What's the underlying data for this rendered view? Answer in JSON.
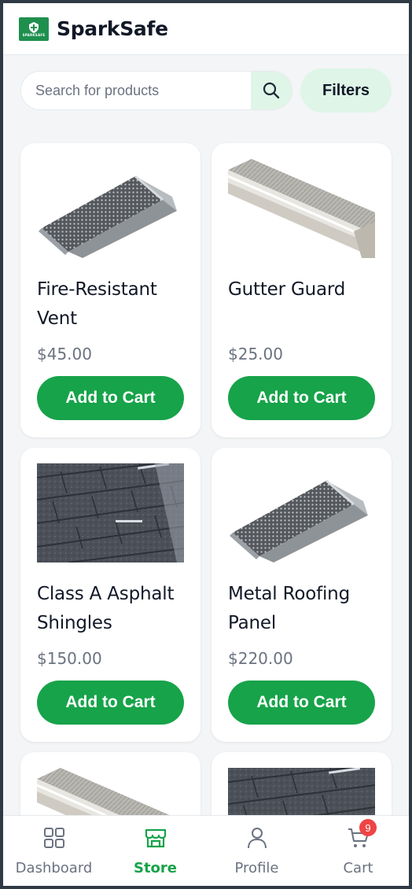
{
  "app": {
    "title": "SparkSafe",
    "logo_text": "SPARKSAFE",
    "brand_color": "#1f8f4e",
    "accent_color": "#17a34a"
  },
  "search": {
    "placeholder": "Search for products",
    "value": "",
    "icon": "search-icon"
  },
  "filters_label": "Filters",
  "products": [
    {
      "name": "Fire-Resistant Vent",
      "price": "$45.00",
      "cta": "Add to Cart",
      "image": "vent"
    },
    {
      "name": "Gutter Guard",
      "price": "$25.00",
      "cta": "Add to Cart",
      "image": "gutter"
    },
    {
      "name": "Class A Asphalt Shingles",
      "price": "$150.00",
      "cta": "Add to Cart",
      "image": "shingles"
    },
    {
      "name": "Metal Roofing Panel",
      "price": "$220.00",
      "cta": "Add to Cart",
      "image": "vent"
    },
    {
      "name": "",
      "price": "",
      "cta": "",
      "image": "gutter"
    },
    {
      "name": "",
      "price": "",
      "cta": "",
      "image": "shingles"
    }
  ],
  "nav": {
    "items": [
      {
        "label": "Dashboard",
        "icon": "grid-icon",
        "active": false
      },
      {
        "label": "Store",
        "icon": "store-icon",
        "active": true
      },
      {
        "label": "Profile",
        "icon": "user-icon",
        "active": false
      },
      {
        "label": "Cart",
        "icon": "cart-icon",
        "active": false
      }
    ],
    "cart_count": "9"
  }
}
